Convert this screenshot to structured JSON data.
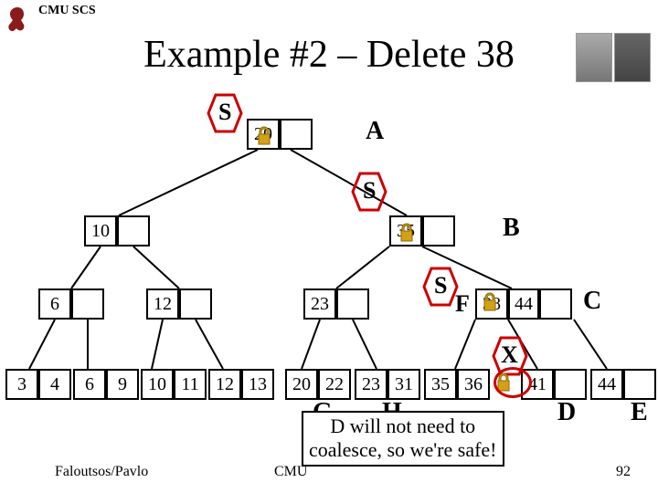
{
  "header": {
    "org": "CMU SCS"
  },
  "title": "Example #2 – Delete 38",
  "nodes": {
    "A": {
      "label": "A",
      "keys": [
        "20"
      ]
    },
    "B": {
      "label": "B",
      "keys": [
        "10",
        "35"
      ]
    },
    "C": {
      "label": "C",
      "keys": [
        "6",
        "12",
        "23",
        "38",
        "44"
      ]
    },
    "leaf1": {
      "keys": [
        "3",
        "4"
      ]
    },
    "leaf2": {
      "keys": [
        "6",
        "9"
      ]
    },
    "leaf3": {
      "keys": [
        "10",
        "11"
      ]
    },
    "leaf4": {
      "keys": [
        "12",
        "13"
      ]
    },
    "leaf5": {
      "keys": [
        "20",
        "22"
      ]
    },
    "leaf6": {
      "keys": [
        "23",
        "31"
      ]
    },
    "leaf7": {
      "keys": [
        "35",
        "36"
      ]
    },
    "leaf8": {
      "keys": [
        "41"
      ]
    },
    "leaf9": {
      "keys": [
        "44"
      ]
    }
  },
  "marks": {
    "S1": "S",
    "S2": "S",
    "S3": "S",
    "F": "F",
    "X": "X"
  },
  "bottom_labels": {
    "G": "G",
    "H": "H",
    "D": "D",
    "E": "E"
  },
  "annotation": {
    "line1": "D will not need to",
    "line2": "coalesce, so we're safe!"
  },
  "footer": {
    "left": "Faloutsos/Pavlo",
    "center": "CMU",
    "right": "92"
  },
  "chart_data": {
    "type": "diagram",
    "structure": "B+ tree",
    "operation": "Delete 38",
    "root": {
      "id": "A",
      "keys": [
        20
      ]
    },
    "level1_left": {
      "keys": [
        10
      ]
    },
    "level1_right": {
      "id": "B",
      "keys": [
        35
      ]
    },
    "level2": [
      {
        "keys": [
          6
        ]
      },
      {
        "keys": [
          12
        ]
      },
      {
        "keys": [
          23
        ]
      },
      {
        "id": "C",
        "keys": [
          38,
          44
        ]
      }
    ],
    "leaves": [
      {
        "keys": [
          3,
          4
        ]
      },
      {
        "keys": [
          6,
          9
        ]
      },
      {
        "keys": [
          10,
          11
        ]
      },
      {
        "keys": [
          12,
          13
        ]
      },
      {
        "id": "G",
        "keys": [
          20,
          22
        ]
      },
      {
        "id": "H",
        "keys": [
          23,
          31
        ]
      },
      {
        "id": "D",
        "keys": [
          35,
          36
        ]
      },
      {
        "keys": [
          41
        ]
      },
      {
        "id": "E",
        "keys": [
          44
        ]
      }
    ],
    "locks_on": [
      "A",
      "B",
      "C-cell-38",
      "leaf7"
    ],
    "deleted_target": 38,
    "annotation": "D will not need to coalesce, so we're safe!"
  }
}
